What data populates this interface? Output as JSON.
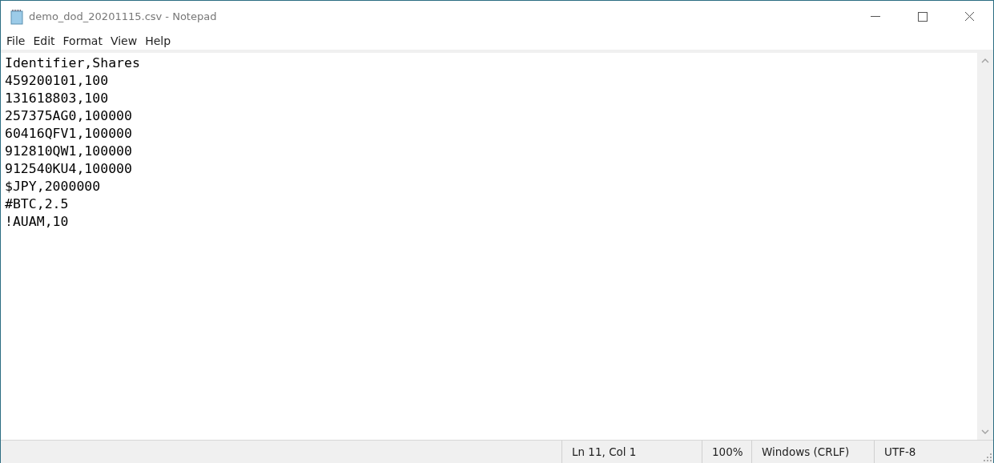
{
  "window": {
    "title": "demo_dod_20201115.csv - Notepad"
  },
  "menu": [
    "File",
    "Edit",
    "Format",
    "View",
    "Help"
  ],
  "editor": {
    "lines": [
      "Identifier,Shares",
      "459200101,100",
      "131618803,100",
      "257375AG0,100000",
      "60416QFV1,100000",
      "912810QW1,100000",
      "912540KU4,100000",
      "$JPY,2000000",
      "#BTC,2.5",
      "!AUAM,10"
    ]
  },
  "status_bar": {
    "position": "Ln 11, Col 1",
    "zoom": "100%",
    "line_ending": "Windows (CRLF)",
    "encoding": "UTF-8"
  }
}
